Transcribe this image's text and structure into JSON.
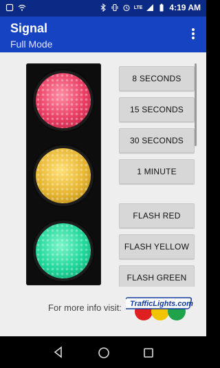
{
  "statusbar": {
    "time": "4:19 AM",
    "network_label": "LTE",
    "icons": [
      "notification-icon",
      "wifi-icon",
      "bluetooth-icon",
      "vibrate-icon",
      "alarm-icon",
      "lte-signal-icon",
      "battery-icon"
    ]
  },
  "appbar": {
    "title": "Signal",
    "subtitle": "Full Mode",
    "menu_icon": "overflow-menu-icon"
  },
  "signal": {
    "lamps": [
      "red",
      "yellow",
      "green"
    ],
    "colors": {
      "red": "#e83d63",
      "yellow": "#e6b531",
      "green": "#20d69a"
    }
  },
  "buttons": {
    "timer": [
      "8 SECONDS",
      "15 SECONDS",
      "30 SECONDS",
      "1 MINUTE"
    ],
    "flash": [
      "FLASH RED",
      "FLASH YELLOW",
      "FLASH GREEN"
    ]
  },
  "footer": {
    "info_text": "For more info visit:",
    "logo_text": "TrafficLights.com"
  },
  "navbar": {
    "icons": [
      "back-icon",
      "home-icon",
      "recents-icon"
    ]
  },
  "colors": {
    "statusbar": "#0b2a86",
    "appbar": "#1543c2",
    "content_bg": "#eeeeee",
    "button_bg": "#d7d7d7"
  }
}
